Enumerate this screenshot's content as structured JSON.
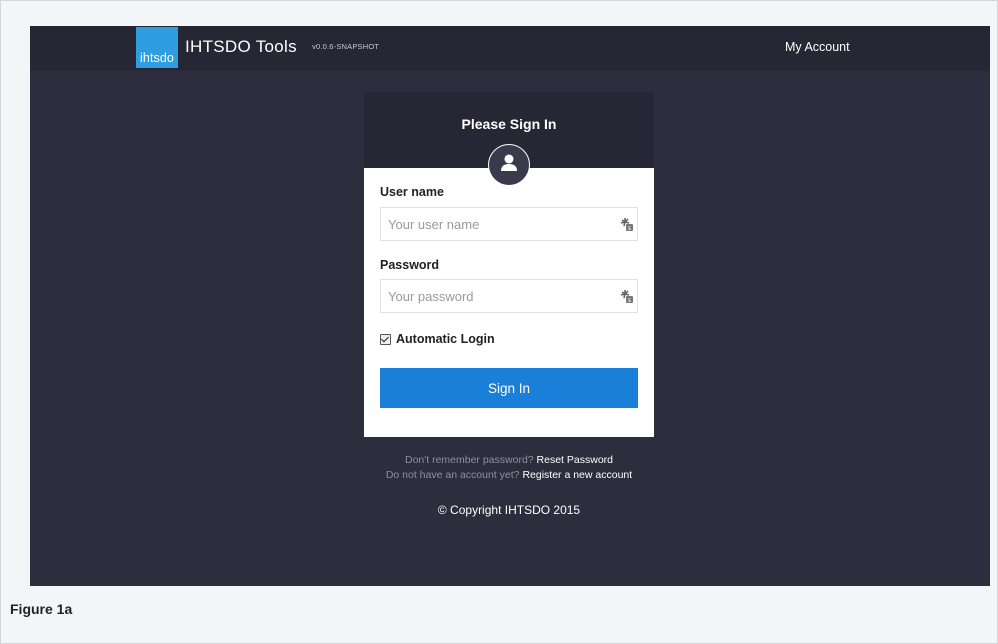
{
  "header": {
    "logo_text": "ihtsdo",
    "brand": "IHTSDO Tools",
    "version": "v0.0.6-SNAPSHOT",
    "account_link": "My Account"
  },
  "login": {
    "title": "Please Sign In",
    "username_label": "User name",
    "username_placeholder": "Your user name",
    "password_label": "Password",
    "password_placeholder": "Your password",
    "remember_label": "Automatic Login",
    "remember_checked": true,
    "submit_label": "Sign In"
  },
  "footer": {
    "forgot_prompt": "Don't remember password?",
    "forgot_link": "Reset Password",
    "register_prompt": "Do not have an account yet?",
    "register_link": "Register a new account",
    "copyright": "© Copyright IHTSDO 2015"
  },
  "caption": "Figure 1a",
  "colors": {
    "background": "#2d2d3d",
    "topbar": "#262635",
    "logo": "#2f9ee0",
    "button": "#1a7fd9"
  },
  "icons": {
    "avatar": "user-icon",
    "field_helper": "password-manager-key-icon"
  }
}
